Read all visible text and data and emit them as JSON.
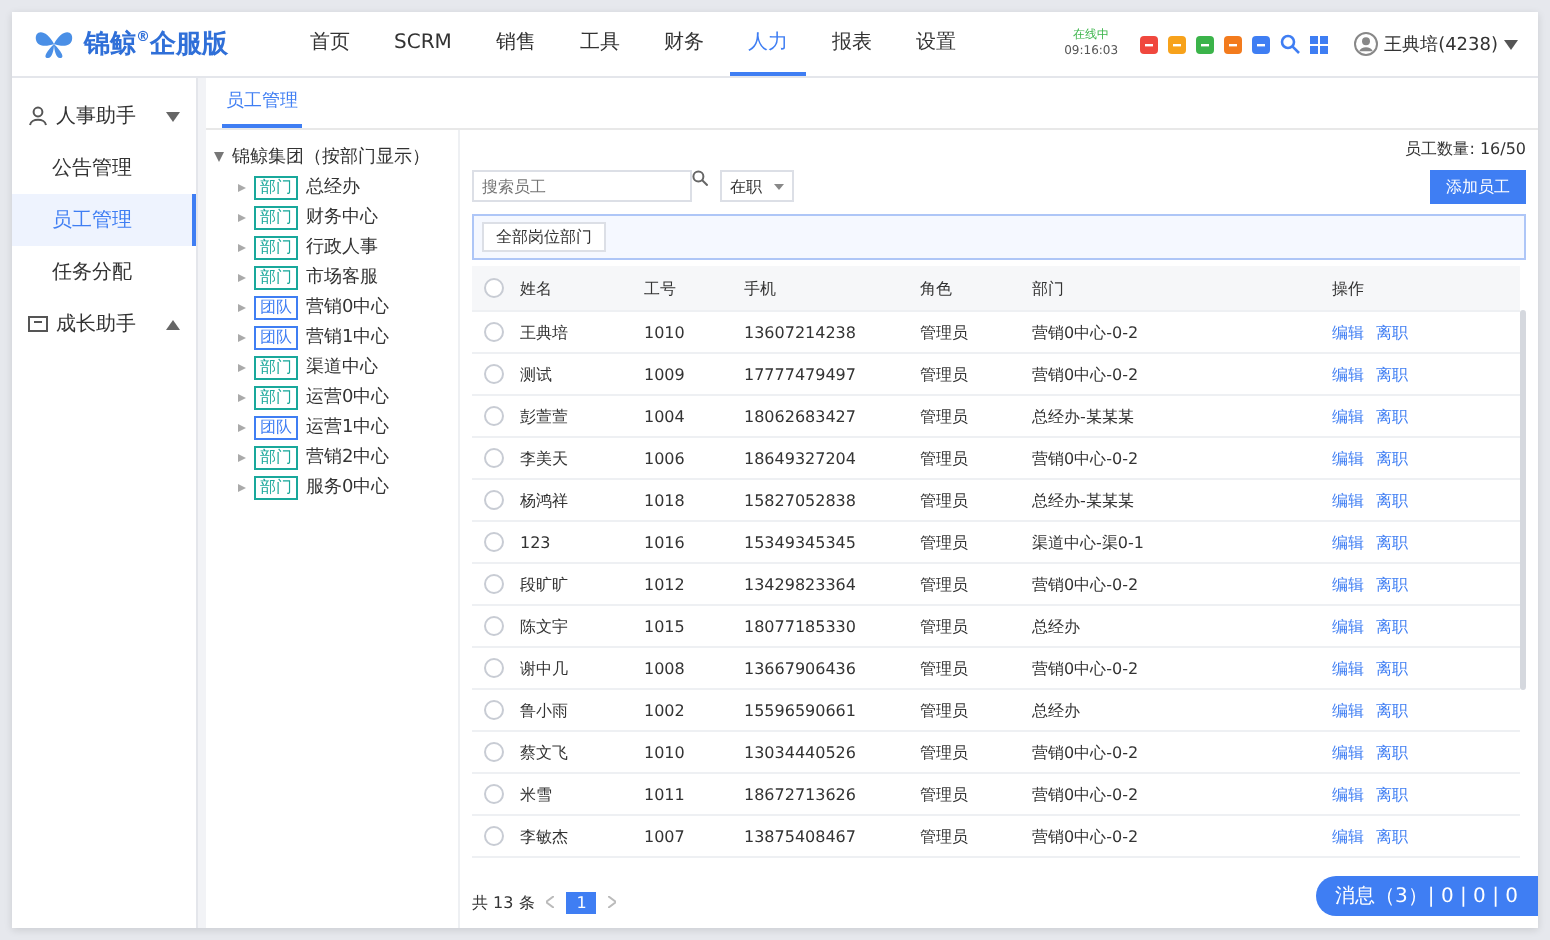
{
  "header": {
    "logo": {
      "name": "锦鲸",
      "mark": "®",
      "edition": "企服版"
    },
    "nav": [
      {
        "label": "首页",
        "selected": false
      },
      {
        "label": "SCRM",
        "selected": false
      },
      {
        "label": "销售",
        "selected": false
      },
      {
        "label": "工具",
        "selected": false
      },
      {
        "label": "财务",
        "selected": false
      },
      {
        "label": "人力",
        "selected": true
      },
      {
        "label": "报表",
        "selected": false
      },
      {
        "label": "设置",
        "selected": false
      }
    ],
    "status": {
      "label": "在线中",
      "time": "09:16:03"
    },
    "shortcuts": [
      {
        "color": "#f0483e"
      },
      {
        "color": "#f7a21b"
      },
      {
        "color": "#3bb44a"
      },
      {
        "color": "#f37b1d"
      },
      {
        "color": "#3f7ef3"
      }
    ],
    "user": {
      "name": "王典培(4238)"
    }
  },
  "sidebar": {
    "groups": [
      {
        "label": "人事助手",
        "expanded": true,
        "items": [
          {
            "label": "公告管理",
            "selected": false
          },
          {
            "label": "员工管理",
            "selected": true
          },
          {
            "label": "任务分配",
            "selected": false
          }
        ]
      },
      {
        "label": "成长助手",
        "expanded": false
      }
    ]
  },
  "tabs": [
    {
      "label": "员工管理",
      "selected": true
    }
  ],
  "tree": {
    "root": {
      "label": "锦鲸集团（按部门显示）",
      "expanded": true,
      "children": [
        {
          "tag": "部门",
          "color": "#19a89b",
          "label": "总经办"
        },
        {
          "tag": "部门",
          "color": "#19a89b",
          "label": "财务中心"
        },
        {
          "tag": "部门",
          "color": "#19a89b",
          "label": "行政人事"
        },
        {
          "tag": "部门",
          "color": "#19a89b",
          "label": "市场客服"
        },
        {
          "tag": "团队",
          "color": "#3f7ef3",
          "label": "营销0中心"
        },
        {
          "tag": "团队",
          "color": "#3f7ef3",
          "label": "营销1中心"
        },
        {
          "tag": "部门",
          "color": "#19a89b",
          "label": "渠道中心"
        },
        {
          "tag": "部门",
          "color": "#19a89b",
          "label": "运营0中心"
        },
        {
          "tag": "团队",
          "color": "#3f7ef3",
          "label": "运营1中心"
        },
        {
          "tag": "部门",
          "color": "#19a89b",
          "label": "营销2中心"
        },
        {
          "tag": "部门",
          "color": "#19a89b",
          "label": "服务0中心"
        }
      ]
    }
  },
  "staff_count": {
    "label": "员工数量:",
    "value": "16/50"
  },
  "search": {
    "placeholder": "搜索员工"
  },
  "status_filter": {
    "value": "在职"
  },
  "add_button": "添加员工",
  "filter_chip": "全部岗位部门",
  "table": {
    "select_all": {
      "checked": false
    },
    "columns": [
      "姓名",
      "工号",
      "手机",
      "角色",
      "部门",
      "操作"
    ],
    "rows": [
      {
        "checked": false,
        "cells": [
          "王典培",
          "1010",
          "13607214238",
          "管理员",
          "营销0中心-0-2"
        ],
        "actions": [
          "编辑",
          "离职"
        ]
      },
      {
        "checked": false,
        "cells": [
          "测试",
          "1009",
          "17777479497",
          "管理员",
          "营销0中心-0-2"
        ],
        "actions": [
          "编辑",
          "离职"
        ]
      },
      {
        "checked": false,
        "cells": [
          "彭萱萱",
          "1004",
          "18062683427",
          "管理员",
          "总经办-某某某"
        ],
        "actions": [
          "编辑",
          "离职"
        ]
      },
      {
        "checked": false,
        "cells": [
          "李美天",
          "1006",
          "18649327204",
          "管理员",
          "营销0中心-0-2"
        ],
        "actions": [
          "编辑",
          "离职"
        ]
      },
      {
        "checked": false,
        "cells": [
          "杨鸿祥",
          "1018",
          "15827052838",
          "管理员",
          "总经办-某某某"
        ],
        "actions": [
          "编辑",
          "离职"
        ]
      },
      {
        "checked": false,
        "cells": [
          "123",
          "1016",
          "15349345345",
          "管理员",
          "渠道中心-渠0-1"
        ],
        "actions": [
          "编辑",
          "离职"
        ]
      },
      {
        "checked": false,
        "cells": [
          "段旷旷",
          "1012",
          "13429823364",
          "管理员",
          "营销0中心-0-2"
        ],
        "actions": [
          "编辑",
          "离职"
        ]
      },
      {
        "checked": false,
        "cells": [
          "陈文宇",
          "1015",
          "18077185330",
          "管理员",
          "总经办"
        ],
        "actions": [
          "编辑",
          "离职"
        ]
      },
      {
        "checked": false,
        "cells": [
          "谢中几",
          "1008",
          "13667906436",
          "管理员",
          "营销0中心-0-2"
        ],
        "actions": [
          "编辑",
          "离职"
        ]
      },
      {
        "checked": false,
        "cells": [
          "鲁小雨",
          "1002",
          "15596590661",
          "管理员",
          "总经办"
        ],
        "actions": [
          "编辑",
          "离职"
        ]
      },
      {
        "checked": false,
        "cells": [
          "蔡文飞",
          "1010",
          "13034440526",
          "管理员",
          "营销0中心-0-2"
        ],
        "actions": [
          "编辑",
          "离职"
        ]
      },
      {
        "checked": false,
        "cells": [
          "米雪",
          "1011",
          "18672713626",
          "管理员",
          "营销0中心-0-2"
        ],
        "actions": [
          "编辑",
          "离职"
        ]
      },
      {
        "checked": false,
        "cells": [
          "李敏杰",
          "1007",
          "13875408467",
          "管理员",
          "营销0中心-0-2"
        ],
        "actions": [
          "编辑",
          "离职"
        ]
      }
    ]
  },
  "pagination": {
    "total": "共 13 条",
    "pages": [
      {
        "label": "1",
        "selected": true
      }
    ]
  },
  "float_bar": {
    "text": "消息（3）| 0 | 0 | 0"
  }
}
